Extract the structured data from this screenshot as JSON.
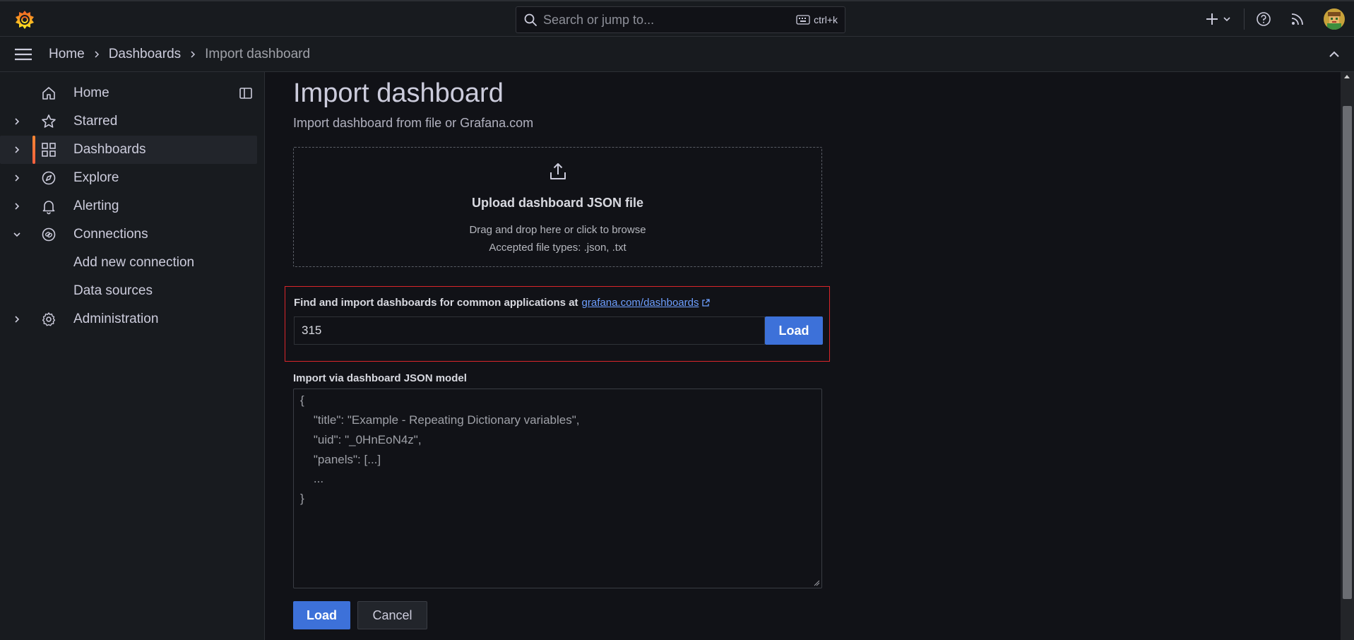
{
  "topbar": {
    "search_placeholder": "Search or jump to...",
    "search_shortcut": "ctrl+k",
    "icons": [
      "grafana-logo-icon",
      "search-icon",
      "keyboard-icon",
      "plus-icon",
      "chevron-down-icon",
      "help-icon",
      "rss-icon",
      "avatar"
    ]
  },
  "breadcrumb": {
    "home": "Home",
    "dashboards": "Dashboards",
    "current": "Import dashboard"
  },
  "sidebar": {
    "items": [
      {
        "label": "Home",
        "icon": "home-icon"
      },
      {
        "label": "Starred",
        "icon": "star-icon"
      },
      {
        "label": "Dashboards",
        "icon": "apps-icon",
        "active": true
      },
      {
        "label": "Explore",
        "icon": "compass-icon"
      },
      {
        "label": "Alerting",
        "icon": "bell-icon"
      },
      {
        "label": "Connections",
        "icon": "link-icon",
        "expanded": true
      },
      {
        "label": "Add new connection"
      },
      {
        "label": "Data sources"
      },
      {
        "label": "Administration",
        "icon": "cog-icon"
      }
    ]
  },
  "main": {
    "title": "Import dashboard",
    "subtitle": "Import dashboard from file or Grafana.com",
    "upload": {
      "title": "Upload dashboard JSON file",
      "text": "Drag and drop here or click to browse",
      "types": "Accepted file types: .json, .txt"
    },
    "grafana_com": {
      "label": "Find and import dashboards for common applications at",
      "link": "grafana.com/dashboards",
      "value": "315",
      "load": "Load"
    },
    "json_model": {
      "label": "Import via dashboard JSON model",
      "lines": [
        "{",
        "    \"title\": \"Example - Repeating Dictionary variables\",",
        "    \"uid\": \"_0HnEoN4z\",",
        "    \"panels\": [...]",
        "    ...",
        "}"
      ]
    },
    "buttons": {
      "load": "Load",
      "cancel": "Cancel"
    }
  },
  "colors": {
    "accent": "#3d71d9",
    "highlight_border": "#d9252a",
    "active_indicator": "#f55f3e",
    "link": "#6e9fff"
  }
}
